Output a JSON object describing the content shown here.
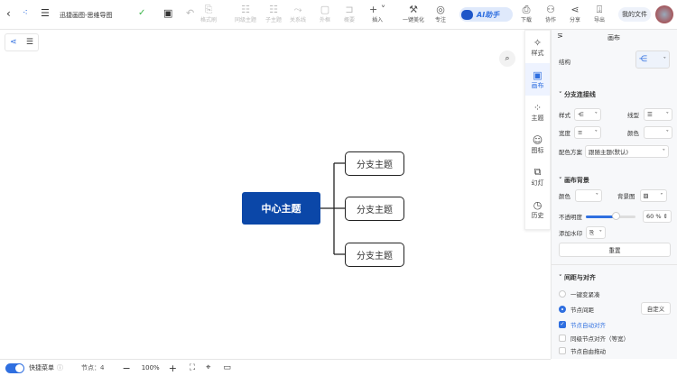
{
  "header": {
    "title": "迅捷画图-思维导图",
    "tools": [
      {
        "label": "格式刷",
        "icon": "format-brush-icon"
      },
      {
        "label": "同级主题",
        "icon": "sibling-topic-icon"
      },
      {
        "label": "子主题",
        "icon": "child-topic-icon"
      },
      {
        "label": "关系线",
        "icon": "relation-line-icon"
      },
      {
        "label": "外框",
        "icon": "frame-icon"
      },
      {
        "label": "概要",
        "icon": "summary-icon"
      },
      {
        "label": "插入",
        "icon": "plus-icon"
      },
      {
        "label": "一键美化",
        "icon": "magic-wand-icon"
      },
      {
        "label": "专注",
        "icon": "focus-icon"
      }
    ],
    "ai_label": "AI助手",
    "right": [
      {
        "label": "下载",
        "icon": "download-icon"
      },
      {
        "label": "协作",
        "icon": "collaborate-icon"
      },
      {
        "label": "分享",
        "icon": "share-icon"
      },
      {
        "label": "导出",
        "icon": "export-icon"
      }
    ],
    "my_files": "我的文件"
  },
  "mindmap": {
    "center": "中心主题",
    "branches": [
      "分支主题",
      "分支主题",
      "分支主题"
    ]
  },
  "vtabs": [
    {
      "label": "样式",
      "icon": "style-icon"
    },
    {
      "label": "画布",
      "icon": "canvas-icon"
    },
    {
      "label": "主题",
      "icon": "theme-icon"
    },
    {
      "label": "图标",
      "icon": "emoji-icon"
    },
    {
      "label": "幻灯",
      "icon": "slides-icon"
    },
    {
      "label": "历史",
      "icon": "history-icon"
    }
  ],
  "panel": {
    "title": "画布",
    "structure_label": "结构",
    "branch_section": "分支连接线",
    "style_label": "样式",
    "line_type_label": "线型",
    "width_label": "宽度",
    "color_label": "颜色",
    "scheme_label": "配色方案",
    "scheme_value": "跟随主题(默认)",
    "bg_section": "画布背景",
    "bg_color_label": "颜色",
    "bg_image_label": "背景图",
    "opacity_label": "不透明度",
    "opacity_value": "60",
    "opacity_unit": "%",
    "opacity": 0.6,
    "watermark_label": "添加水印",
    "reset": "重置",
    "spacing_section": "间距与对齐",
    "compact": "一键变紧凑",
    "node_spacing": "节点间距",
    "custom": "自定义",
    "auto_align": "节点自动对齐",
    "sibling_align": "同级节点对齐（等宽）",
    "free_drag": "节点自由拖动"
  },
  "bottom": {
    "quick_menu": "快捷菜单",
    "nodes": "节点：4",
    "zoom": "100%"
  },
  "colors": {
    "primary": "#2f6fe0",
    "center_node": "#0b47a8"
  }
}
